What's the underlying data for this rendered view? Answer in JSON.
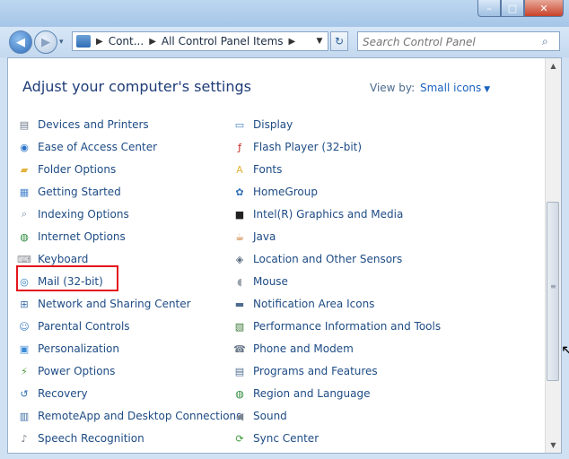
{
  "titlebar": {
    "minimize": "–",
    "maximize": "□",
    "close": "✕"
  },
  "nav": {
    "address": [
      "Cont...",
      "All Control Panel Items"
    ],
    "search_placeholder": "Search Control Panel"
  },
  "content": {
    "heading": "Adjust your computer's settings",
    "view_by_label": "View by:",
    "view_by_value": "Small icons"
  },
  "items_left": [
    {
      "label": "Devices and Printers",
      "icon": "printer-icon",
      "color": "#6b7a8c",
      "glyph": "▤"
    },
    {
      "label": "Ease of Access Center",
      "icon": "ease-of-access-icon",
      "color": "#2a73c9",
      "glyph": "◉"
    },
    {
      "label": "Folder Options",
      "icon": "folder-icon",
      "color": "#e3b33b",
      "glyph": "▰"
    },
    {
      "label": "Getting Started",
      "icon": "getting-started-icon",
      "color": "#4a86cf",
      "glyph": "▦"
    },
    {
      "label": "Indexing Options",
      "icon": "indexing-icon",
      "color": "#7e8fa3",
      "glyph": "⌕"
    },
    {
      "label": "Internet Options",
      "icon": "internet-icon",
      "color": "#2d8a3c",
      "glyph": "◍"
    },
    {
      "label": "Keyboard",
      "icon": "keyboard-icon",
      "color": "#8a8f96",
      "glyph": "⌨"
    },
    {
      "label": "Mail (32-bit)",
      "icon": "mail-icon",
      "color": "#2d7fbf",
      "glyph": "◎"
    },
    {
      "label": "Network and Sharing Center",
      "icon": "network-icon",
      "color": "#3b6fa8",
      "glyph": "⊞"
    },
    {
      "label": "Parental Controls",
      "icon": "parental-controls-icon",
      "color": "#3c83c5",
      "glyph": "☺"
    },
    {
      "label": "Personalization",
      "icon": "personalization-icon",
      "color": "#3a8ad6",
      "glyph": "▣"
    },
    {
      "label": "Power Options",
      "icon": "power-icon",
      "color": "#4c9a3a",
      "glyph": "⚡"
    },
    {
      "label": "Recovery",
      "icon": "recovery-icon",
      "color": "#2f6bb0",
      "glyph": "↺"
    },
    {
      "label": "RemoteApp and Desktop Connections",
      "icon": "remoteapp-icon",
      "color": "#3b6fa8",
      "glyph": "▥"
    },
    {
      "label": "Speech Recognition",
      "icon": "microphone-icon",
      "color": "#707a85",
      "glyph": "♪"
    }
  ],
  "items_right": [
    {
      "label": "Display",
      "icon": "display-icon",
      "color": "#3f7fc2",
      "glyph": "▭"
    },
    {
      "label": "Flash Player (32-bit)",
      "icon": "flash-icon",
      "color": "#c4231a",
      "glyph": "ƒ"
    },
    {
      "label": "Fonts",
      "icon": "fonts-icon",
      "color": "#e3b33b",
      "glyph": "A"
    },
    {
      "label": "HomeGroup",
      "icon": "homegroup-icon",
      "color": "#2f6fb8",
      "glyph": "✿"
    },
    {
      "label": "Intel(R) Graphics and Media",
      "icon": "intel-graphics-icon",
      "color": "#222",
      "glyph": "■"
    },
    {
      "label": "Java",
      "icon": "java-icon",
      "color": "#c96a1a",
      "glyph": "☕"
    },
    {
      "label": "Location and Other Sensors",
      "icon": "location-icon",
      "color": "#5a6b80",
      "glyph": "◈"
    },
    {
      "label": "Mouse",
      "icon": "mouse-icon",
      "color": "#9aa3ad",
      "glyph": "◖"
    },
    {
      "label": "Notification Area Icons",
      "icon": "notification-icon",
      "color": "#4d6c8f",
      "glyph": "▬"
    },
    {
      "label": "Performance Information and Tools",
      "icon": "performance-icon",
      "color": "#3b7a3a",
      "glyph": "▧"
    },
    {
      "label": "Phone and Modem",
      "icon": "phone-icon",
      "color": "#6b7a8c",
      "glyph": "☎"
    },
    {
      "label": "Programs and Features",
      "icon": "programs-icon",
      "color": "#4f6f93",
      "glyph": "▤"
    },
    {
      "label": "Region and Language",
      "icon": "region-icon",
      "color": "#2d8a3c",
      "glyph": "◍"
    },
    {
      "label": "Sound",
      "icon": "sound-icon",
      "color": "#7b8591",
      "glyph": "◀"
    },
    {
      "label": "Sync Center",
      "icon": "sync-icon",
      "color": "#3c9a3a",
      "glyph": "⟳"
    }
  ]
}
